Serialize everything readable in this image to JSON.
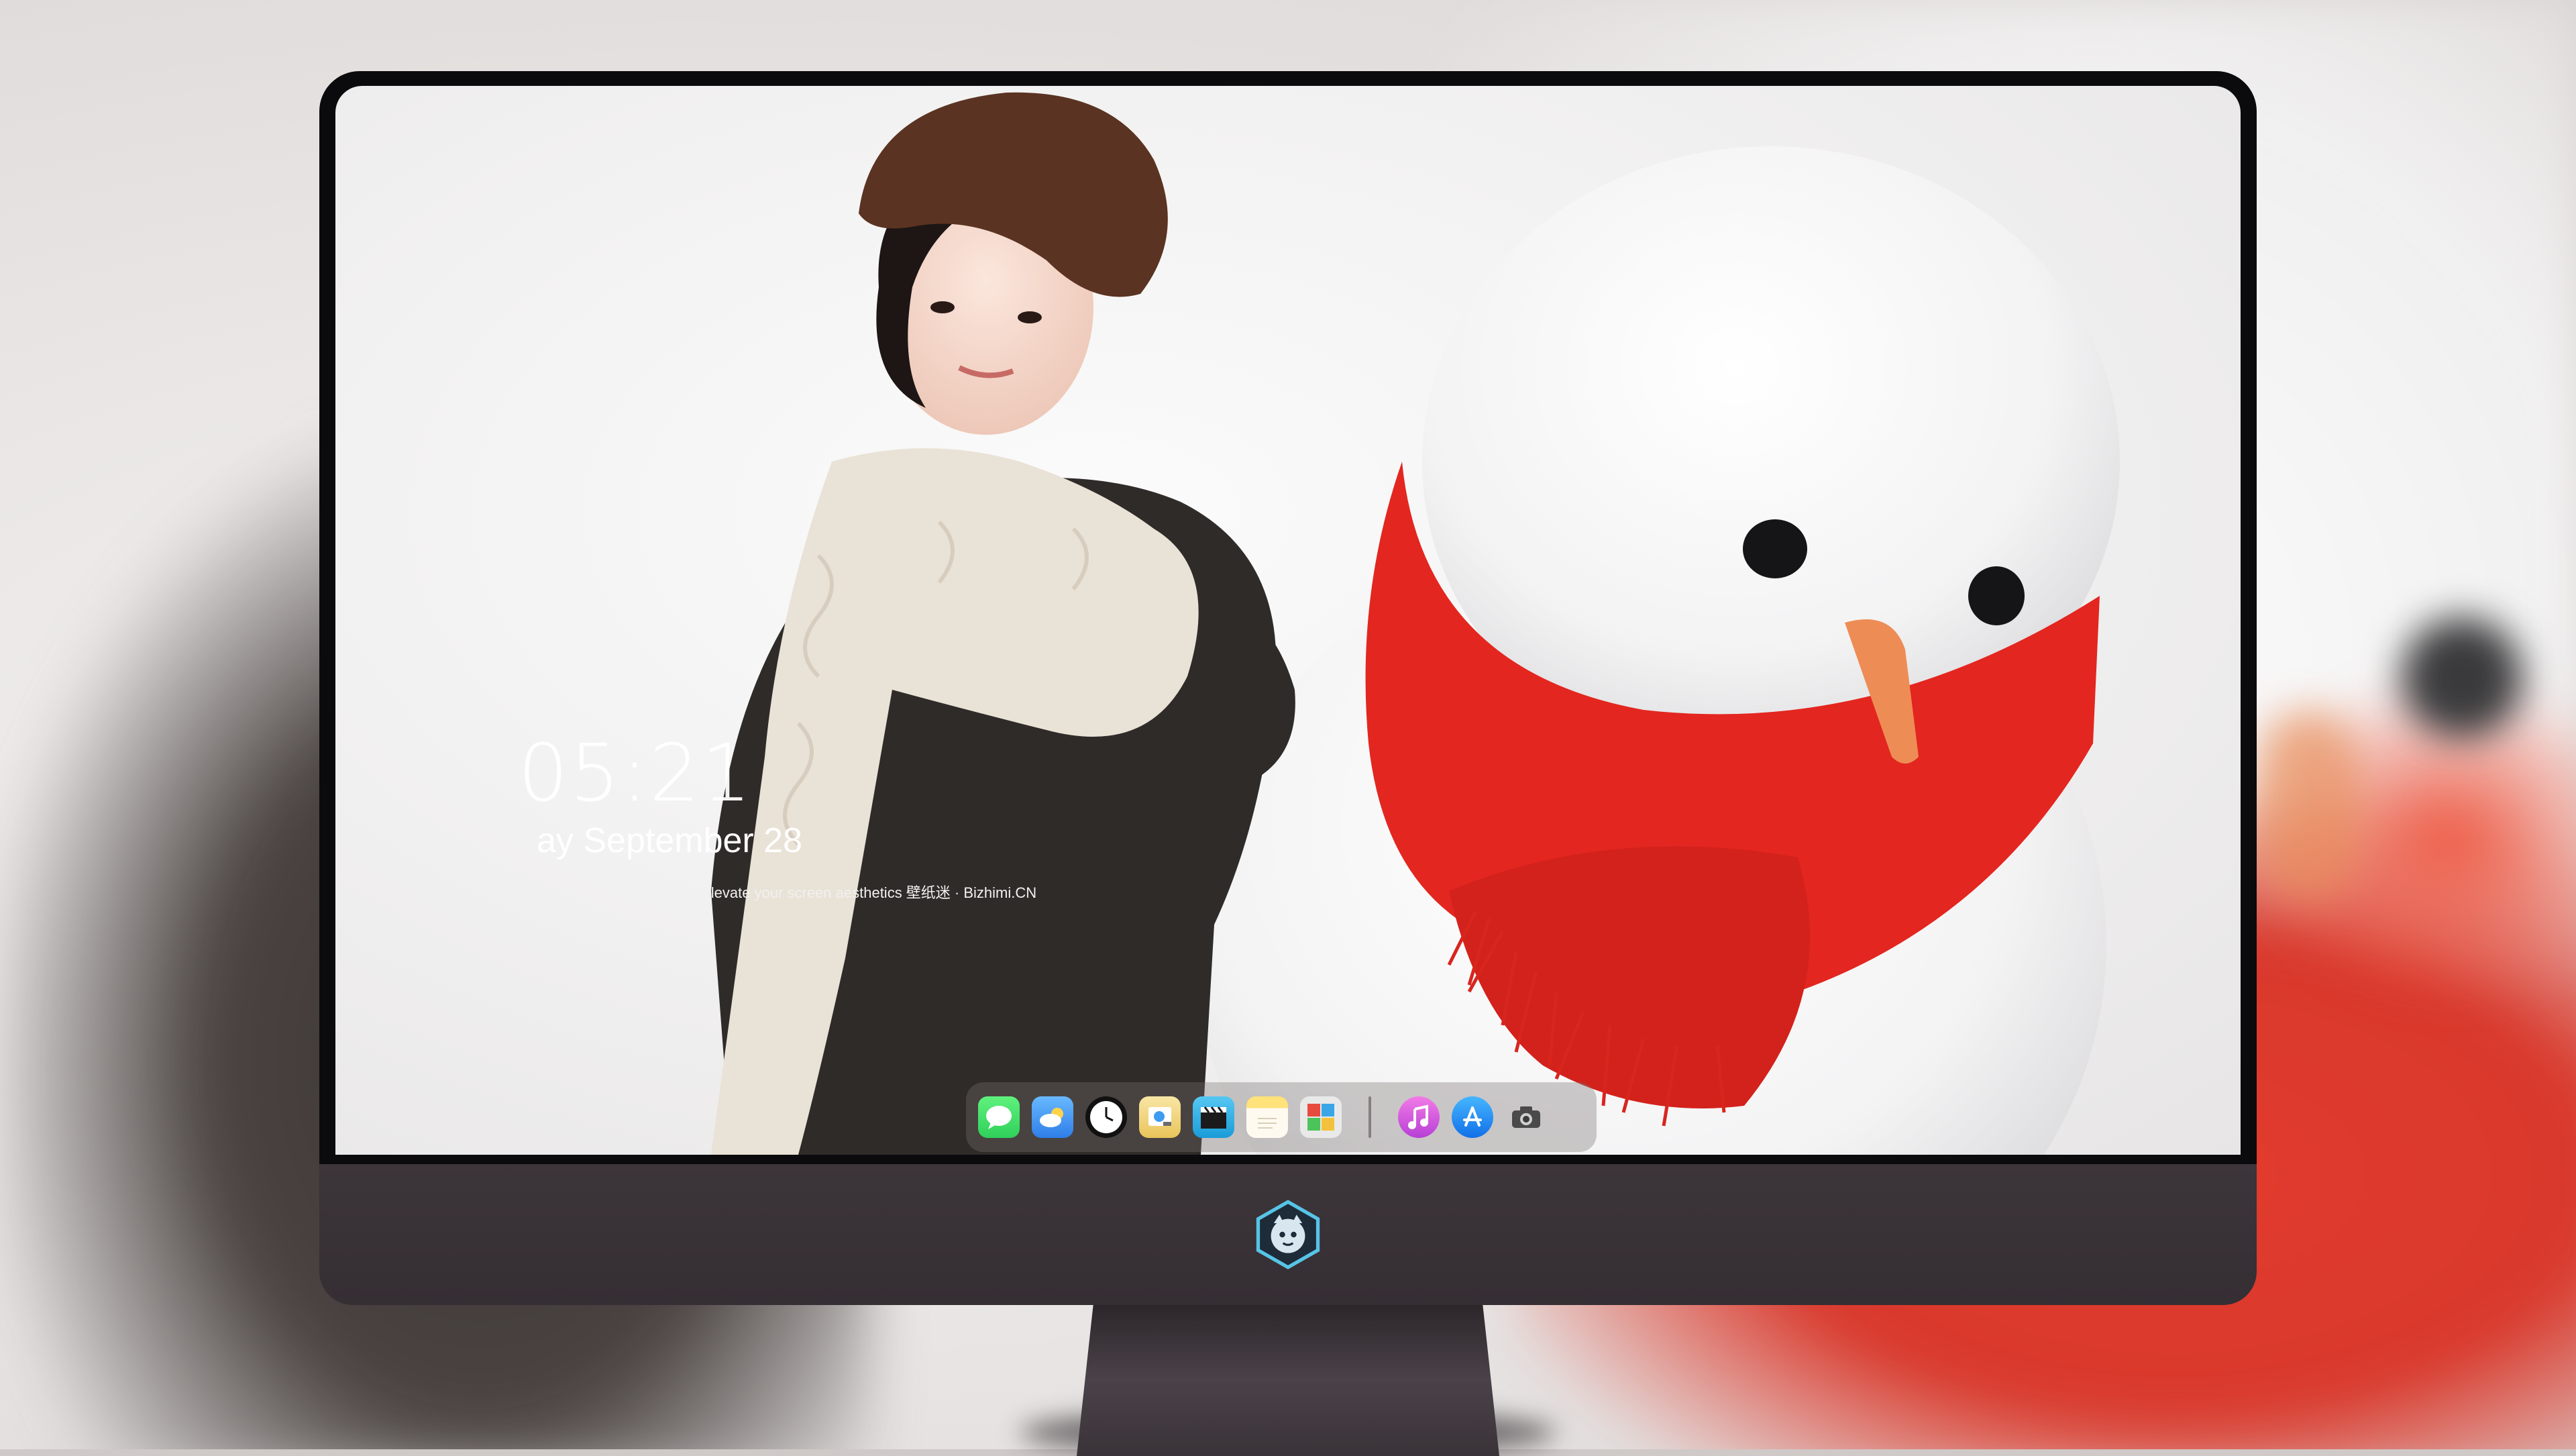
{
  "lockscreen": {
    "time": "05:21",
    "date": "ay September 28",
    "caption": "ning wallpapers. Elevate your screen aesthetics 壁纸迷 · Bizhimi.CN"
  },
  "dock": {
    "apps": [
      {
        "name": "Messages",
        "icon": "messages-icon",
        "color": "#2fd05a"
      },
      {
        "name": "Weather",
        "icon": "weather-icon",
        "color": "#3d9bf0"
      },
      {
        "name": "Clock",
        "icon": "clock-icon",
        "color": "#111111"
      },
      {
        "name": "Preview",
        "icon": "preview-icon",
        "color": "#f2c94c"
      },
      {
        "name": "Final Cut",
        "icon": "clapperboard-icon",
        "color": "#1a9cd8"
      },
      {
        "name": "Notes",
        "icon": "notes-icon",
        "color": "#ffd75e"
      },
      {
        "name": "Photo Booth",
        "icon": "photo-booth-icon",
        "color": "#e84a3e"
      },
      {
        "name": "iTunes",
        "icon": "music-icon",
        "color": "#d04be0"
      },
      {
        "name": "App Store",
        "icon": "app-store-icon",
        "color": "#1b88f5"
      },
      {
        "name": "Camera",
        "icon": "camera-icon",
        "color": "#4a4a4a"
      }
    ]
  },
  "colors": {
    "scarf": "#e3261f",
    "beret": "#5a3322",
    "coat": "#2f2b29",
    "bezel": "#0b0b0d",
    "chin": "#3a3337"
  }
}
